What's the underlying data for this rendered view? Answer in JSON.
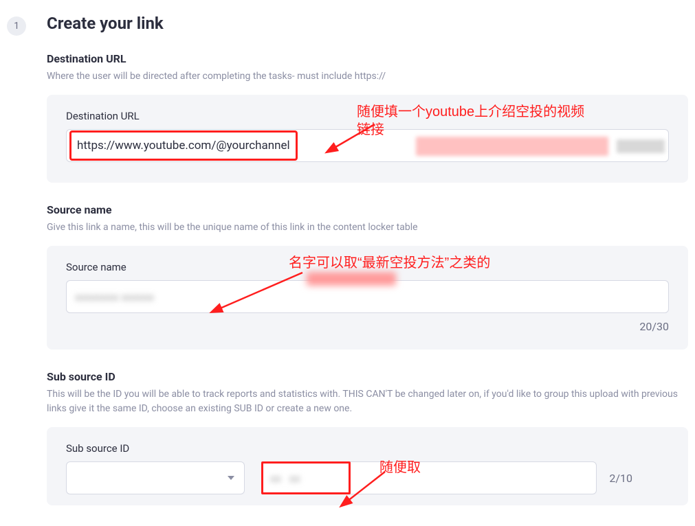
{
  "step_number": "1",
  "step_title": "Create your link",
  "dest": {
    "heading": "Destination URL",
    "desc": "Where the user will be directed after completing the tasks- must include https://",
    "field_label": "Destination URL",
    "value": "https://www.youtube.com/@yourchannel"
  },
  "source": {
    "heading": "Source name",
    "desc": "Give this link a name, this will be the unique name of this link in the content locker table",
    "field_label": "Source name",
    "counter": "20/30"
  },
  "sub": {
    "heading": "Sub source ID",
    "desc": "This will be the ID you will be able to track reports and statistics with. THIS CAN'T be changed later on, if you'd like to group this upload with previous links give it the same ID, choose an existing SUB ID or create a new one.",
    "field_label": "Sub source ID",
    "counter": "2/10"
  },
  "annotations": {
    "a1_line1": "随便填一个youtube上介绍空投的视频",
    "a1_line2": "链接",
    "a2": "名字可以取“最新空投方法”之类的",
    "a3": "随便取"
  }
}
